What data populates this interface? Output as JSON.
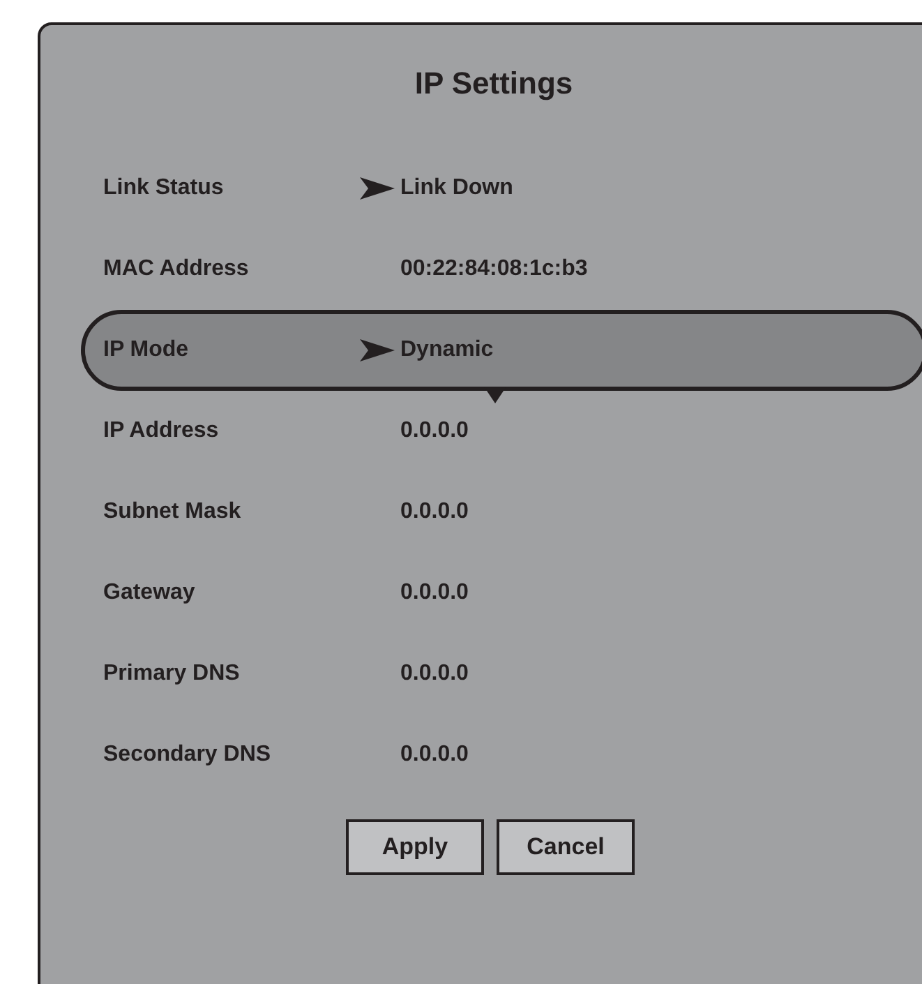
{
  "title": "IP Settings",
  "rows": [
    {
      "label": "Link Status",
      "value": "Link Down",
      "arrow": true,
      "selected": false
    },
    {
      "label": "MAC Address",
      "value": "00:22:84:08:1c:b3",
      "arrow": false,
      "selected": false
    },
    {
      "label": "IP Mode",
      "value": "Dynamic",
      "arrow": true,
      "selected": true
    },
    {
      "label": "IP Address",
      "value": "0.0.0.0",
      "arrow": false,
      "selected": false
    },
    {
      "label": "Subnet Mask",
      "value": "0.0.0.0",
      "arrow": false,
      "selected": false
    },
    {
      "label": "Gateway",
      "value": "0.0.0.0",
      "arrow": false,
      "selected": false
    },
    {
      "label": "Primary DNS",
      "value": "0.0.0.0",
      "arrow": false,
      "selected": false
    },
    {
      "label": "Secondary DNS",
      "value": "0.0.0.0",
      "arrow": false,
      "selected": false
    }
  ],
  "buttons": [
    "Apply",
    "Cancel"
  ]
}
